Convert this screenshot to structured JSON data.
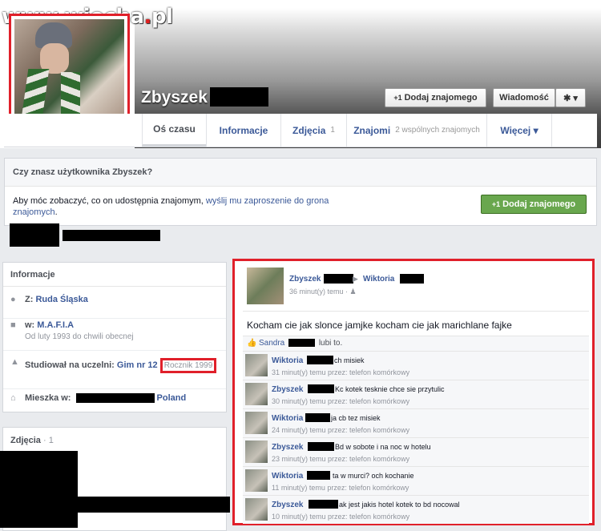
{
  "watermark": {
    "text": "www.wiocha",
    "dot": ".",
    "tld": "pl"
  },
  "profile": {
    "name": "Zbyszek"
  },
  "header_buttons": {
    "add_friend": "Dodaj znajomego",
    "message": "Wiadomość",
    "gear": "✱ ▾",
    "add_icon": "+1"
  },
  "tabs": [
    {
      "label": "Oś czasu",
      "sub": ""
    },
    {
      "label": "Informacje",
      "sub": ""
    },
    {
      "label": "Zdjęcia",
      "sub": "1"
    },
    {
      "label": "Znajomi",
      "sub": "2 wspólnych znajomych"
    },
    {
      "label": "Więcej ▾",
      "sub": ""
    }
  ],
  "know_box": {
    "title": "Czy znasz użytkownika Zbyszek?",
    "text_before": "Aby móc zobaczyć, co on udostępnia znajomym, ",
    "text_link": "wyślij mu zaproszenie do grona znajomych",
    "text_after": ".",
    "button": "Dodaj znajomego"
  },
  "info": {
    "title": "Informacje",
    "location_prefix": "Z: ",
    "location": "Ruda Śląska",
    "work_prefix": "w: ",
    "work": "M.A.F.I.A",
    "work_sub": "Od luty 1993 do chwili obecnej",
    "school_prefix": "Studiował na uczelni: ",
    "school": "Gim nr 12",
    "school_sub": "Rocznik 1999",
    "lives_prefix": "Mieszka w: ",
    "lives_country": "Poland"
  },
  "photos": {
    "title": "Zdjęcia",
    "count": "· 1"
  },
  "post": {
    "author": "Zbyszek",
    "arrow": "▶",
    "target": "Wiktoria",
    "time": "36 minut(y) temu · ♟",
    "text": "Kocham cie jak slonce jamjke kocham cie jak marichlane fajke",
    "likes_name": "Sandra",
    "likes_rest": "lubi to.",
    "comments": [
      {
        "name": "Wiktoria",
        "text": "ch misiek",
        "meta": "31 minut(y) temu przez: telefon komórkowy"
      },
      {
        "name": "Zbyszek",
        "text": "Kc kotek tesknie chce sie przytulic",
        "meta": "30 minut(y) temu przez: telefon komórkowy"
      },
      {
        "name": "Wiktoria",
        "text": "ja cb tez misiek",
        "meta": "24 minut(y) temu przez: telefon komórkowy"
      },
      {
        "name": "Zbyszek",
        "text": "Bd w sobote i na noc w hotelu",
        "meta": "23 minut(y) temu przez: telefon komórkowy"
      },
      {
        "name": "Wiktoria",
        "text": "ta w murci? och kochanie",
        "meta": "11 minut(y) temu przez: telefon komórkowy"
      },
      {
        "name": "Zbyszek",
        "text": "ak jest jakis hotel kotek to bd nocowal",
        "meta": "10 minut(y) temu przez: telefon komórkowy"
      }
    ]
  },
  "colors": {
    "fb_blue": "#3b5998",
    "highlight_red": "#e0202a",
    "green_button": "#69a74e"
  }
}
